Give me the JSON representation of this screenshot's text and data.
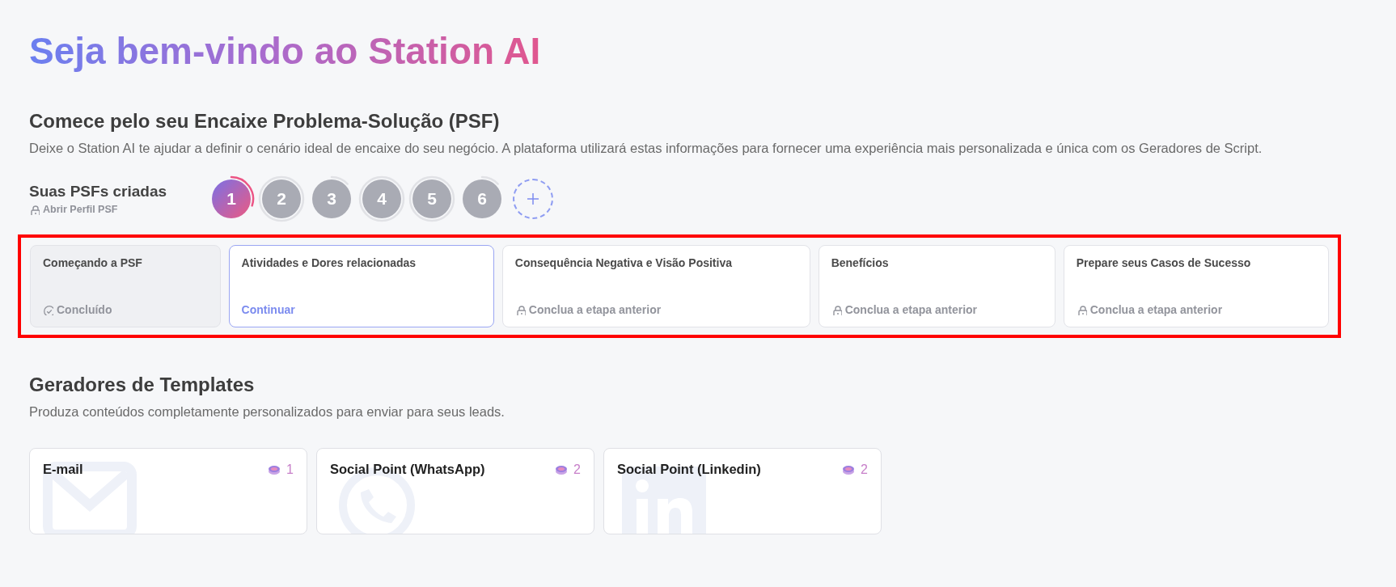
{
  "title": "Seja bem-vindo ao Station AI",
  "psf_section": {
    "heading": "Comece pelo seu Encaixe Problema-Solução (PSF)",
    "description": "Deixe o Station AI te ajudar a definir o cenário ideal de encaixe do seu negócio. A plataforma utilizará estas informações para fornecer uma experiência mais personalizada e única com os Geradores de Script.",
    "created_label": "Suas PSFs criadas",
    "profile_link": "Abrir Perfil PSF",
    "psfs": [
      {
        "label": "1",
        "selected": true,
        "kind": "arc"
      },
      {
        "label": "2",
        "selected": false,
        "kind": "ring"
      },
      {
        "label": "3",
        "selected": false,
        "kind": "arc"
      },
      {
        "label": "4",
        "selected": false,
        "kind": "ring"
      },
      {
        "label": "5",
        "selected": false,
        "kind": "ring"
      },
      {
        "label": "6",
        "selected": false,
        "kind": "arc"
      }
    ],
    "highlighted": true,
    "steps": [
      {
        "title": "Começando a PSF",
        "kind": "done",
        "status_text": "Concluído"
      },
      {
        "title": "Atividades e Dores relacionadas",
        "kind": "current",
        "status_text": "Continuar"
      },
      {
        "title": "Consequência Negativa e Visão Positiva",
        "kind": "locked",
        "status_text": "Conclua a etapa anterior"
      },
      {
        "title": "Benefícios",
        "kind": "locked",
        "status_text": "Conclua a etapa anterior"
      },
      {
        "title": "Prepare seus Casos de Sucesso",
        "kind": "locked",
        "status_text": "Conclua a etapa anterior"
      }
    ]
  },
  "templates_section": {
    "heading": "Geradores de Templates",
    "description": "Produza conteúdos completamente personalizados para enviar para seus leads.",
    "templates": [
      {
        "title": "E-mail",
        "kind": "email",
        "credits": "1"
      },
      {
        "title": "Social Point (WhatsApp)",
        "kind": "whatsapp",
        "credits": "2"
      },
      {
        "title": "Social Point (Linkedin)",
        "kind": "linkedin",
        "credits": "2"
      }
    ]
  }
}
